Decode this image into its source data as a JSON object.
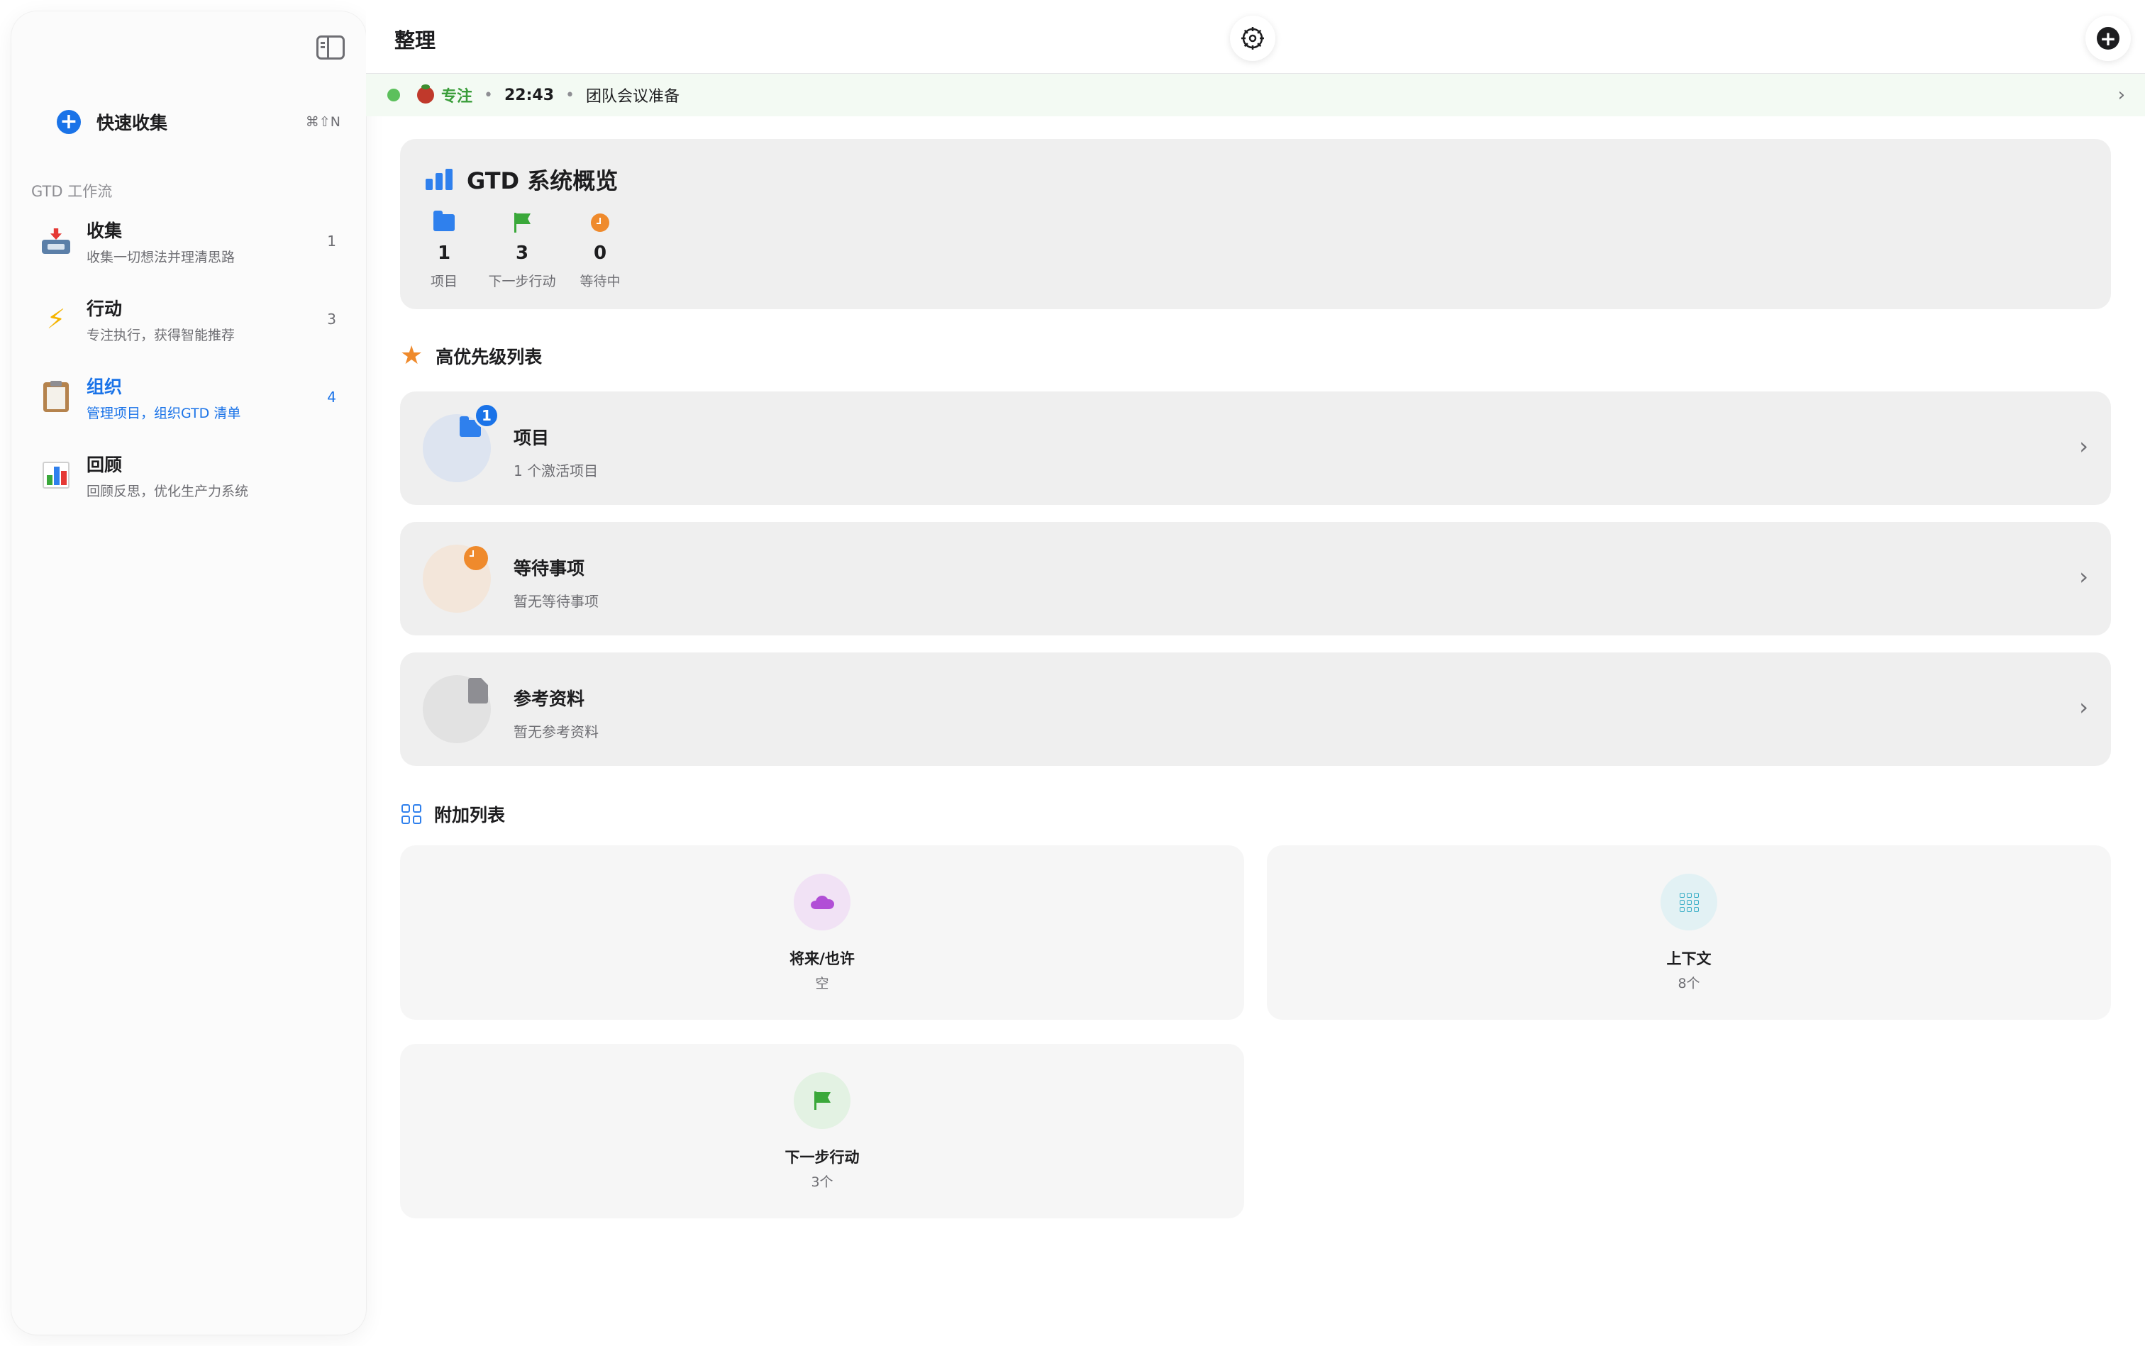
{
  "sidebar": {
    "quick_capture": {
      "label": "快速收集",
      "shortcut": "⌘⇧N"
    },
    "section_title": "GTD 工作流",
    "items": [
      {
        "title": "收集",
        "subtitle": "收集一切想法并理清思路",
        "count": "1",
        "icon": "inbox-tray-icon"
      },
      {
        "title": "行动",
        "subtitle": "专注执行，获得智能推荐",
        "count": "3",
        "icon": "lightning-icon"
      },
      {
        "title": "组织",
        "subtitle": "管理项目，组织GTD 清单",
        "count": "4",
        "icon": "clipboard-icon",
        "active": true
      },
      {
        "title": "回顾",
        "subtitle": "回顾反思，优化生产力系统",
        "count": "",
        "icon": "bar-chart-icon"
      }
    ]
  },
  "header": {
    "title": "整理"
  },
  "focus_bar": {
    "status": "专注",
    "time": "22:43",
    "task": "团队会议准备",
    "separator": "•"
  },
  "overview": {
    "title": "GTD 系统概览",
    "stats": [
      {
        "value": "1",
        "label": "项目",
        "icon": "folder-icon"
      },
      {
        "value": "3",
        "label": "下一步行动",
        "icon": "flag-icon"
      },
      {
        "value": "0",
        "label": "等待中",
        "icon": "clock-icon"
      }
    ]
  },
  "priority_section": {
    "title": "高优先级列表",
    "cards": [
      {
        "title": "项目",
        "subtitle": "1 个激活项目",
        "badge": "1",
        "icon": "folder-icon"
      },
      {
        "title": "等待事项",
        "subtitle": "暂无等待事项",
        "icon": "clock-icon"
      },
      {
        "title": "参考资料",
        "subtitle": "暂无参考资料",
        "icon": "document-icon"
      }
    ]
  },
  "extra_section": {
    "title": "附加列表",
    "tiles": [
      {
        "title": "将来/也许",
        "subtitle": "空",
        "icon": "cloud-icon"
      },
      {
        "title": "上下文",
        "subtitle": "8个",
        "icon": "grid-dots-icon"
      },
      {
        "title": "下一步行动",
        "subtitle": "3个",
        "icon": "flag-icon"
      }
    ]
  },
  "colors": {
    "accent": "#1a73e8",
    "focus_green": "#3a9d3a",
    "orange": "#ef8a2c",
    "purple": "#b14fd6",
    "teal": "#3aaec7"
  }
}
